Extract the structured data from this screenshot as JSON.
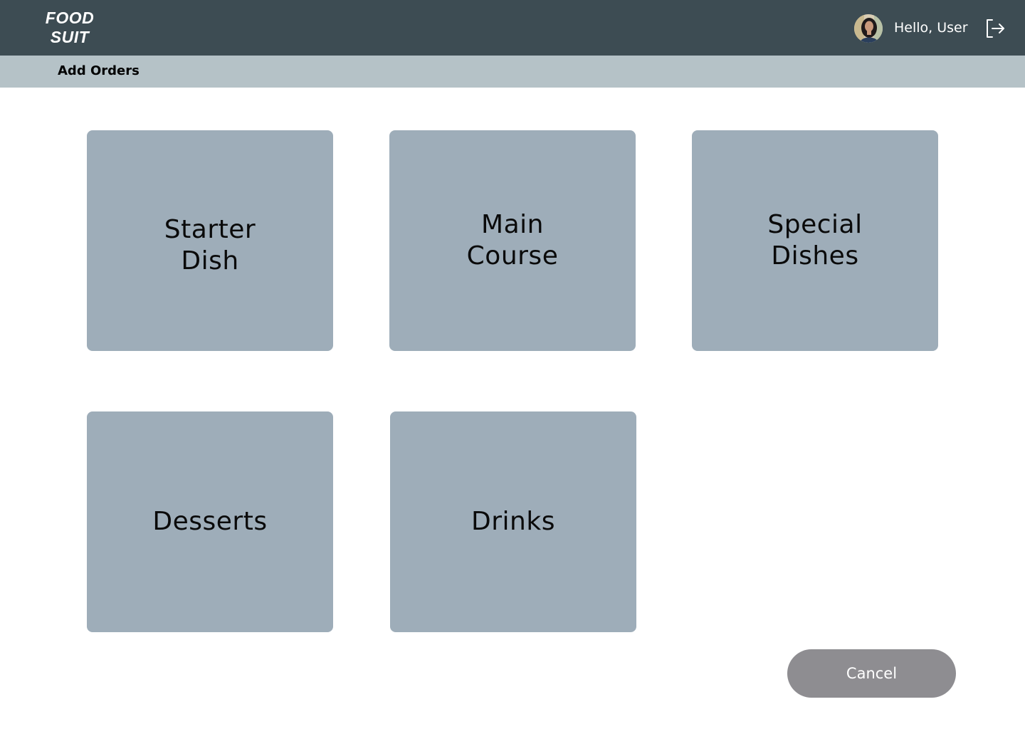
{
  "header": {
    "logo_line1": "FOOD",
    "logo_line2": "SUIT",
    "greeting": "Hello, User",
    "avatar_icon": "user-avatar",
    "logout_icon": "logout-icon",
    "background_color": "#3d4c53"
  },
  "subheader": {
    "title": "Add Orders",
    "background_color": "#b5c2c7"
  },
  "categories": [
    {
      "label": "Starter\nDish"
    },
    {
      "label": "Main\nCourse"
    },
    {
      "label": "Special\nDishes"
    },
    {
      "label": "Desserts"
    },
    {
      "label": "Drinks"
    }
  ],
  "tile_color": "#9eadb9",
  "actions": {
    "cancel_label": "Cancel",
    "cancel_color": "#8e8d91"
  }
}
